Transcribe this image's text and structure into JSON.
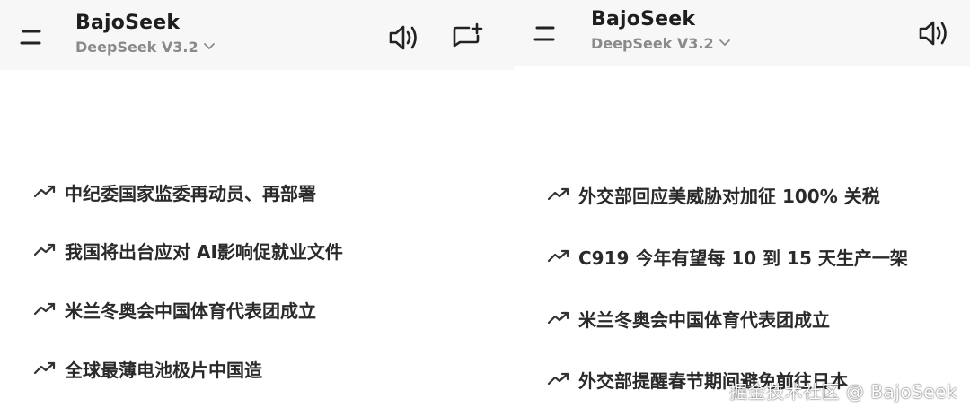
{
  "colors": {
    "header_bg": "#f7f7f7",
    "text": "#2a2a2a",
    "muted": "#8a8a8a"
  },
  "left": {
    "header": {
      "menu_icon": "menu-icon",
      "title": "BajoSeek",
      "model": "DeepSeek V3.2",
      "actions": [
        "speaker-icon",
        "new-chat-icon"
      ]
    },
    "suggestions": [
      {
        "icon": "trending-icon",
        "label": "中纪委国家监委再动员、再部署"
      },
      {
        "icon": "trending-icon",
        "label": "我国将出台应对 AI影响促就业文件"
      },
      {
        "icon": "trending-icon",
        "label": "米兰冬奥会中国体育代表团成立"
      },
      {
        "icon": "trending-icon",
        "label": "全球最薄电池极片中国造"
      }
    ]
  },
  "right": {
    "header": {
      "menu_icon": "menu-icon",
      "title": "BajoSeek",
      "model": "DeepSeek V3.2",
      "actions": [
        "speaker-icon"
      ]
    },
    "suggestions": [
      {
        "icon": "trending-icon",
        "label": "外交部回应美威胁对加征 100% 关税"
      },
      {
        "icon": "trending-icon",
        "label": "C919 今年有望每 10 到 15 天生产一架"
      },
      {
        "icon": "trending-icon",
        "label": "米兰冬奥会中国体育代表团成立"
      },
      {
        "icon": "trending-icon",
        "label": "外交部提醒春节期间避免前往日本"
      }
    ]
  },
  "watermark": "掘金技术社区 @ BajoSeek"
}
